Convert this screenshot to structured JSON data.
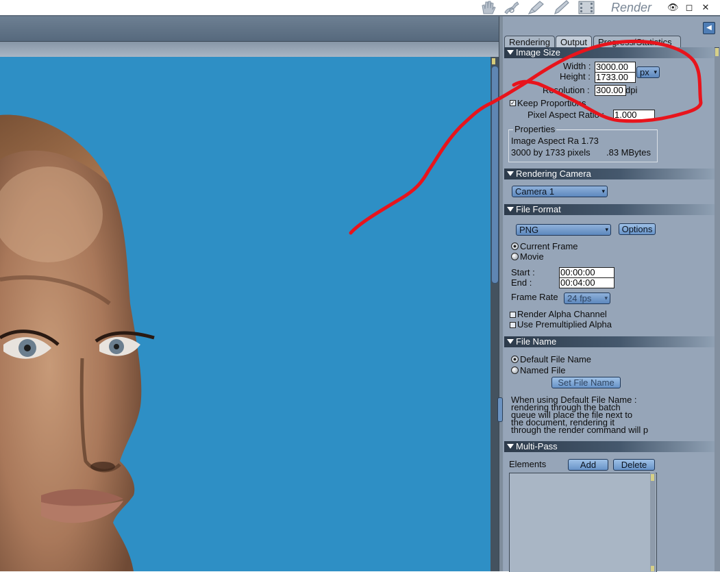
{
  "room": {
    "title": "Render"
  },
  "toolbar": {
    "icons": [
      "hand-icon",
      "figure-icon",
      "brush-icon",
      "pencil-icon",
      "film-icon"
    ]
  },
  "window_controls": {
    "eye": "👁",
    "restore": "◻",
    "close": "✕"
  },
  "tabs": [
    {
      "label": "Rendering"
    },
    {
      "label": "Output"
    },
    {
      "label": "Progress/Statistics"
    }
  ],
  "image_size": {
    "title": "Image Size",
    "width_label": "Width :",
    "width_value": "3000.00",
    "height_label": "Height :",
    "height_value": "1733.00",
    "unit": "px",
    "resolution_label": "Resolution :",
    "resolution_value": "300.00",
    "resolution_unit": "dpi",
    "keep_proportions": "Keep Proportions",
    "pixel_aspect_label": "Pixel Aspect Ratio :",
    "pixel_aspect_value": "1.000",
    "properties_title": "Properties",
    "aspect_line": "Image Aspect Ra 1.73",
    "pixels_line": "3000 by 1733 pixels",
    "mbytes_line": ".83 MBytes"
  },
  "rendering_camera": {
    "title": "Rendering Camera",
    "camera": "Camera 1"
  },
  "file_format": {
    "title": "File Format",
    "format": "PNG",
    "options_label": "Options",
    "current_frame": "Current Frame",
    "movie": "Movie",
    "start_label": "Start :",
    "start_value": "00:00:00",
    "end_label": "End :",
    "end_value": "00:04:00",
    "frame_rate_label": "Frame Rate",
    "frame_rate_value": "24 fps",
    "render_alpha": "Render Alpha Channel",
    "premultiplied": "Use Premultiplied Alpha"
  },
  "file_name": {
    "title": "File Name",
    "default_name": "Default File Name",
    "named_file": "Named File",
    "set_name_label": "Set File Name",
    "note_1": "When using Default File Name :",
    "note_2": "rendering through the batch",
    "note_3": "queue will place the file next to",
    "note_4": "the document, rendering it",
    "note_5": "through the render command will p"
  },
  "multi_pass": {
    "title": "Multi-Pass",
    "elements_label": "Elements",
    "add_label": "Add",
    "delete_label": "Delete"
  },
  "colors": {
    "scene_bg": "#2e8fc5",
    "panel_bg": "#96a5b8",
    "annotation": "#e8141c"
  }
}
